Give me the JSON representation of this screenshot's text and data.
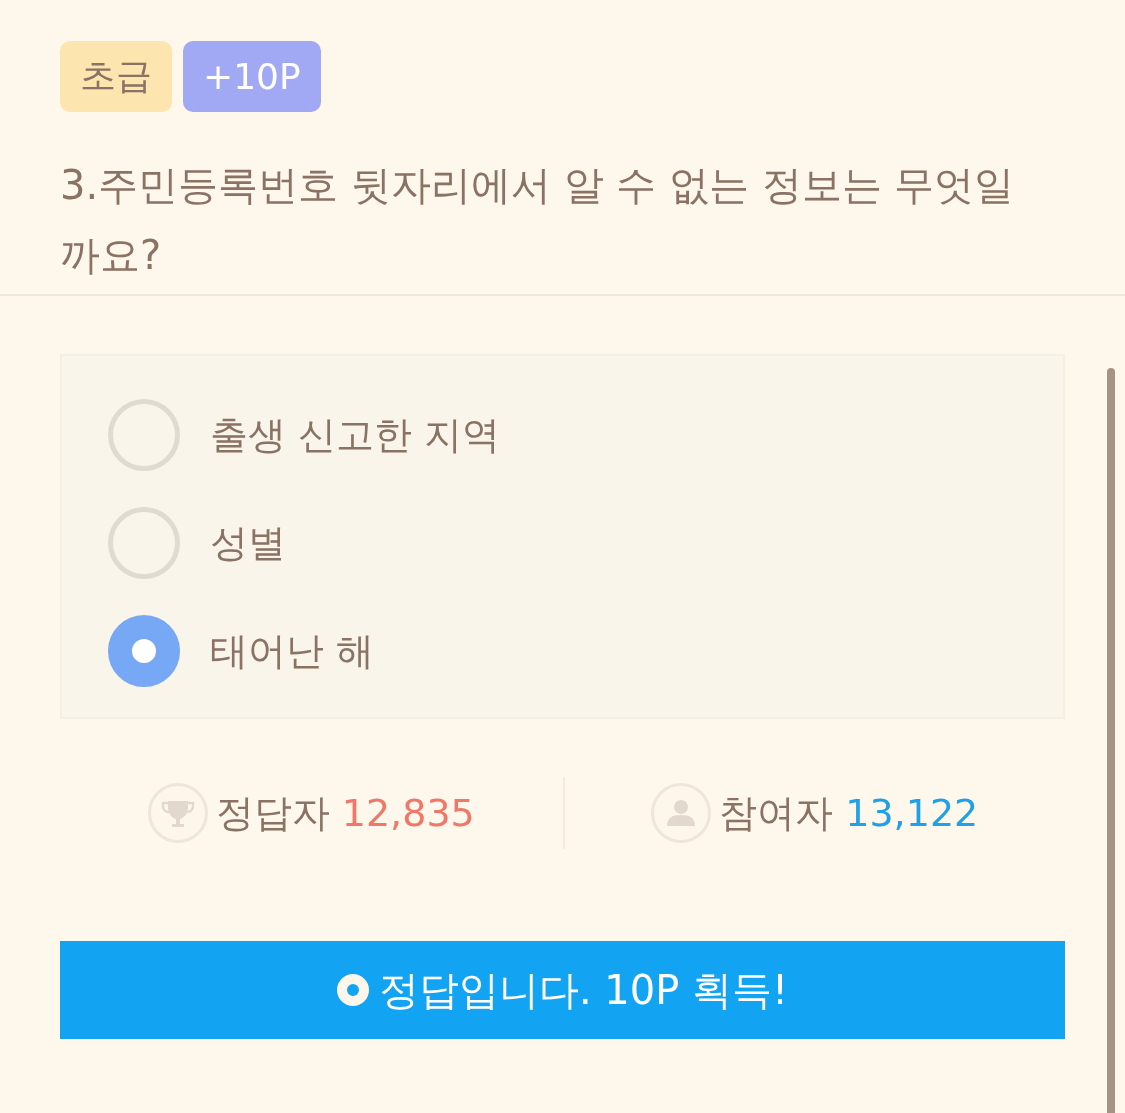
{
  "tags": [
    {
      "label": "초급",
      "kind": "level"
    },
    {
      "label": "+10P",
      "kind": "points"
    }
  ],
  "question": "3.주민등록번호 뒷자리에서 알 수 없는 정보는 무엇일까요?",
  "options": [
    {
      "label": "출생 신고한 지역",
      "selected": false
    },
    {
      "label": "성별",
      "selected": false
    },
    {
      "label": "태어난 해",
      "selected": true
    }
  ],
  "stats": [
    {
      "kind": "correct",
      "label": "정답자",
      "value": "12,835"
    },
    {
      "kind": "participants",
      "label": "참여자",
      "value": "13,122"
    }
  ],
  "result": {
    "message": "정답입니다. 10P 획득!"
  }
}
